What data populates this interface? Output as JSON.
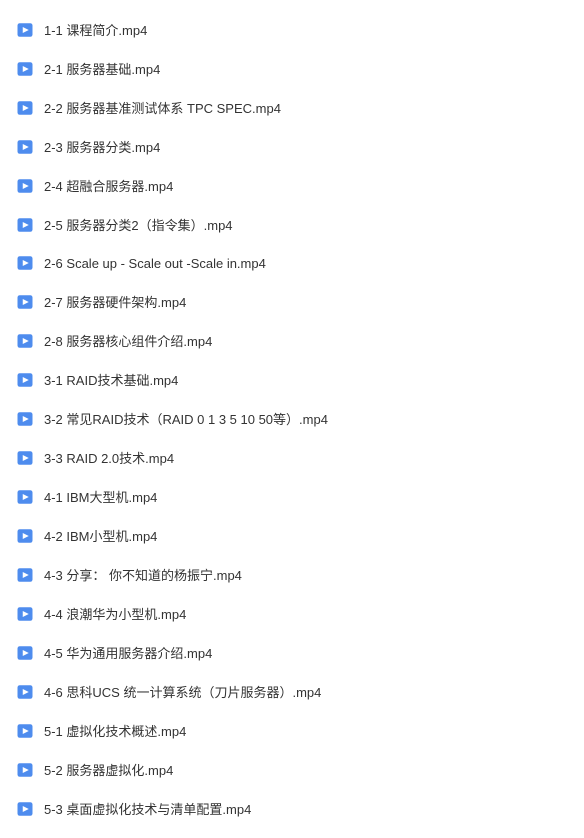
{
  "files": [
    {
      "name": "1-1 课程简介.mp4"
    },
    {
      "name": "2-1 服务器基础.mp4"
    },
    {
      "name": "2-2 服务器基准测试体系 TPC SPEC.mp4"
    },
    {
      "name": "2-3 服务器分类.mp4"
    },
    {
      "name": "2-4 超融合服务器.mp4"
    },
    {
      "name": "2-5 服务器分类2（指令集）.mp4"
    },
    {
      "name": "2-6 Scale up - Scale out -Scale in.mp4"
    },
    {
      "name": "2-7 服务器硬件架构.mp4"
    },
    {
      "name": "2-8 服务器核心组件介绍.mp4"
    },
    {
      "name": "3-1 RAID技术基础.mp4"
    },
    {
      "name": "3-2 常见RAID技术（RAID 0 1 3 5 10 50等）.mp4"
    },
    {
      "name": "3-3 RAID 2.0技术.mp4"
    },
    {
      "name": "4-1 IBM大型机.mp4"
    },
    {
      "name": "4-2 IBM小型机.mp4"
    },
    {
      "name": "4-3 分享： 你不知道的杨振宁.mp4"
    },
    {
      "name": "4-4 浪潮华为小型机.mp4"
    },
    {
      "name": "4-5 华为通用服务器介绍.mp4"
    },
    {
      "name": "4-6 思科UCS 统一计算系统（刀片服务器）.mp4"
    },
    {
      "name": "5-1 虚拟化技术概述.mp4"
    },
    {
      "name": "5-2 服务器虚拟化.mp4"
    },
    {
      "name": "5-3 桌面虚拟化技术与清单配置.mp4"
    }
  ],
  "icon_color": "#4e8cee"
}
